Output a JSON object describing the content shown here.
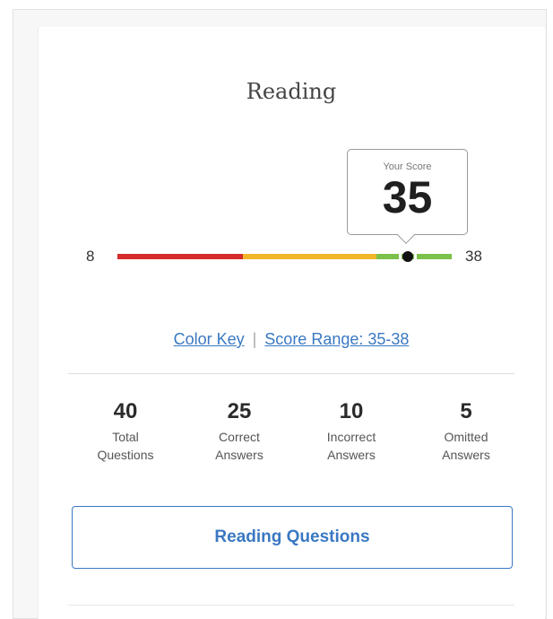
{
  "section": {
    "title": "Reading"
  },
  "score": {
    "label": "Your Score",
    "value": "35",
    "scale_min": "8",
    "scale_max": "38",
    "marker_fraction": 0.9,
    "colors": {
      "low": "#d52b2b",
      "mid": "#f1b62a",
      "high": "#7cc14a"
    }
  },
  "links": {
    "color_key": "Color Key",
    "separator": "|",
    "score_range": "Score Range: 35-38"
  },
  "stats": [
    {
      "value": "40",
      "label_line1": "Total",
      "label_line2": "Questions"
    },
    {
      "value": "25",
      "label_line1": "Correct",
      "label_line2": "Answers"
    },
    {
      "value": "10",
      "label_line1": "Incorrect",
      "label_line2": "Answers"
    },
    {
      "value": "5",
      "label_line1": "Omitted",
      "label_line2": "Answers"
    }
  ],
  "action": {
    "button_label": "Reading Questions"
  },
  "accent_color": "#3a78c2"
}
